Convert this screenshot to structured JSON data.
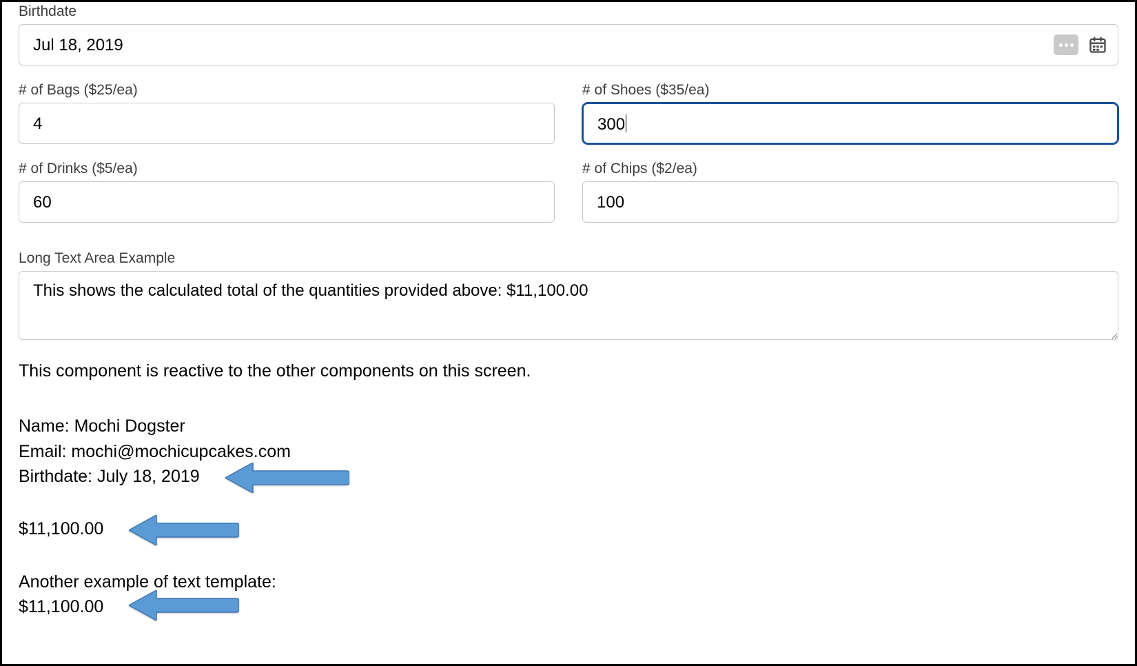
{
  "birthdate": {
    "label": "Birthdate",
    "value": "Jul 18, 2019"
  },
  "bags": {
    "label": "# of Bags ($25/ea)",
    "value": "4"
  },
  "shoes": {
    "label": "# of Shoes ($35/ea)",
    "value": "300"
  },
  "drinks": {
    "label": "# of Drinks ($5/ea)",
    "value": "60"
  },
  "chips": {
    "label": "# of Chips ($2/ea)",
    "value": "100"
  },
  "longtext": {
    "label": "Long Text Area Example",
    "value": "This shows the calculated total of the quantities provided above: $11,100.00"
  },
  "reactive_note": "This component is reactive to the other components on this screen.",
  "info": {
    "name_line": "Name: Mochi Dogster",
    "email_line": "Email: mochi@mochicupcakes.com",
    "birthdate_line": "Birthdate: July 18, 2019"
  },
  "total_line": "$11,100.00",
  "another": {
    "label": "Another example of text template:",
    "value": "$11,100.00"
  },
  "colors": {
    "arrow": "#5b9bd5",
    "arrow_stroke": "#3f78b5"
  }
}
